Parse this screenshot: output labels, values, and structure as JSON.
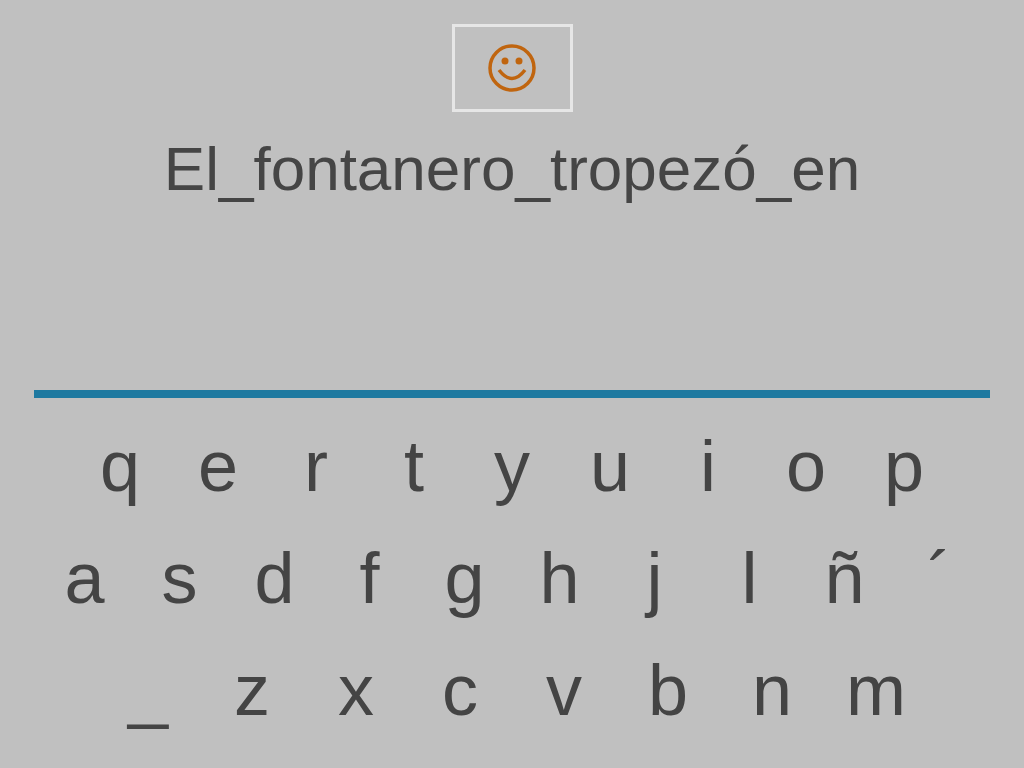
{
  "sentence": "El_fontanero_tropezó_en",
  "keyboard": {
    "rows": [
      [
        "q",
        "e",
        "r",
        "t",
        "y",
        "u",
        "i",
        "o",
        "p"
      ],
      [
        "a",
        "s",
        "d",
        "f",
        "g",
        "h",
        "j",
        "l",
        "ñ",
        "´"
      ],
      [
        "_",
        "z",
        "x",
        "c",
        "v",
        "b",
        "n",
        "m"
      ]
    ]
  }
}
